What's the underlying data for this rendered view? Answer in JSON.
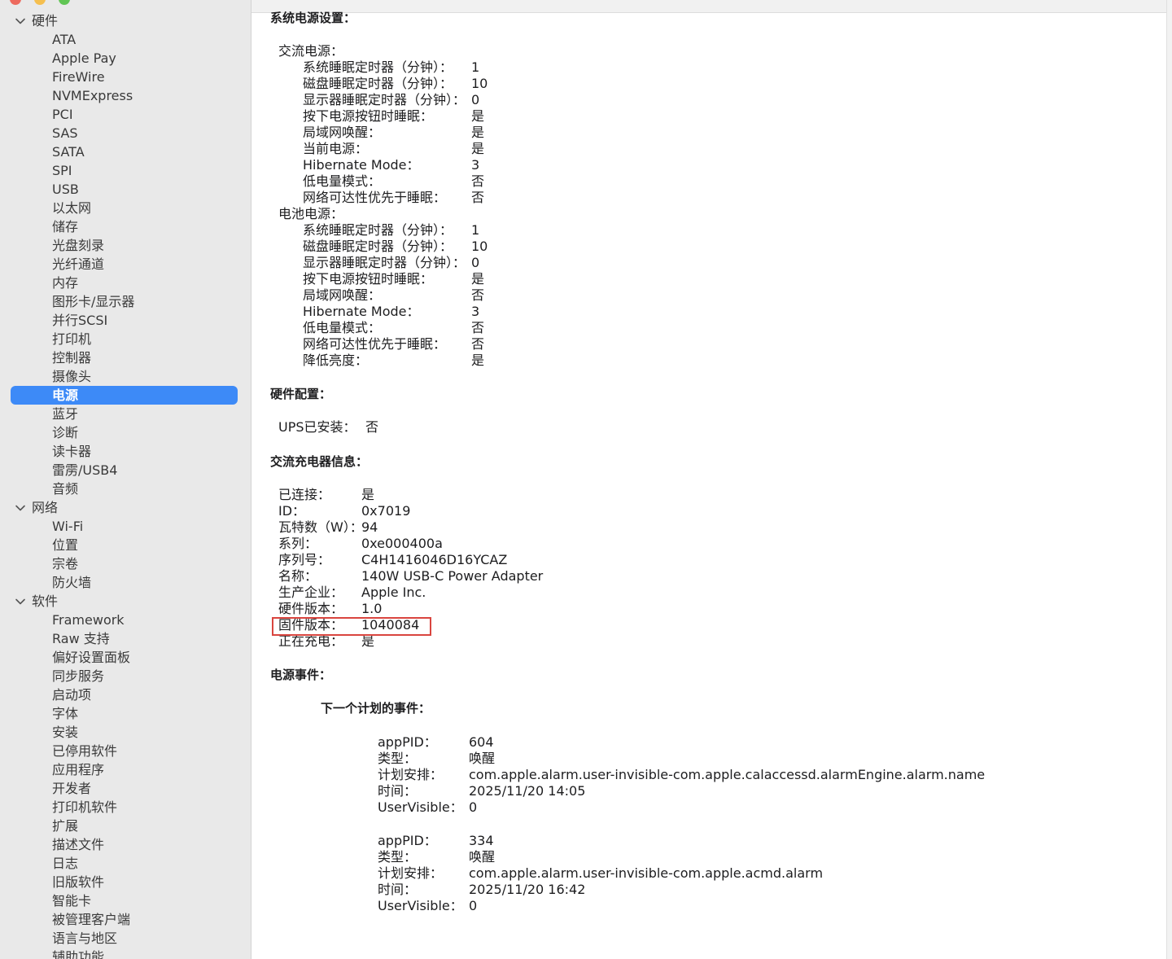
{
  "sidebar": {
    "groups": [
      {
        "label": "硬件",
        "items": [
          "ATA",
          "Apple Pay",
          "FireWire",
          "NVMExpress",
          "PCI",
          "SAS",
          "SATA",
          "SPI",
          "USB",
          "以太网",
          "储存",
          "光盘刻录",
          "光纤通道",
          "内存",
          "图形卡/显示器",
          "并行SCSI",
          "打印机",
          "控制器",
          "摄像头",
          "电源",
          "蓝牙",
          "诊断",
          "读卡器",
          "雷雳/USB4",
          "音频"
        ]
      },
      {
        "label": "网络",
        "items": [
          "Wi-Fi",
          "位置",
          "宗卷",
          "防火墙"
        ]
      },
      {
        "label": "软件",
        "items": [
          "Framework",
          "Raw 支持",
          "偏好设置面板",
          "同步服务",
          "启动项",
          "字体",
          "安装",
          "已停用软件",
          "应用程序",
          "开发者",
          "打印机软件",
          "扩展",
          "描述文件",
          "日志",
          "旧版软件",
          "智能卡",
          "被管理客户端",
          "语言与地区",
          "辅助功能"
        ]
      }
    ],
    "selected": "电源"
  },
  "main": {
    "system_power": {
      "heading": "系统电源设置：",
      "ac": {
        "label": "交流电源：",
        "rows": [
          [
            "系统睡眠定时器（分钟）：",
            "1"
          ],
          [
            "磁盘睡眠定时器（分钟）：",
            "10"
          ],
          [
            "显示器睡眠定时器（分钟）：",
            "0"
          ],
          [
            "按下电源按钮时睡眠：",
            "是"
          ],
          [
            "局域网唤醒：",
            "是"
          ],
          [
            "当前电源：",
            "是"
          ],
          [
            "Hibernate Mode：",
            "3"
          ],
          [
            "低电量模式：",
            "否"
          ],
          [
            "网络可达性优先于睡眠：",
            "否"
          ]
        ]
      },
      "battery": {
        "label": "电池电源：",
        "rows": [
          [
            "系统睡眠定时器（分钟）：",
            "1"
          ],
          [
            "磁盘睡眠定时器（分钟）：",
            "10"
          ],
          [
            "显示器睡眠定时器（分钟）：",
            "0"
          ],
          [
            "按下电源按钮时睡眠：",
            "是"
          ],
          [
            "局域网唤醒：",
            "否"
          ],
          [
            "Hibernate Mode：",
            "3"
          ],
          [
            "低电量模式：",
            "否"
          ],
          [
            "网络可达性优先于睡眠：",
            "否"
          ],
          [
            "降低亮度：",
            "是"
          ]
        ]
      }
    },
    "hardware_config": {
      "heading": "硬件配置：",
      "rows": [
        [
          "UPS已安装：",
          "否"
        ]
      ]
    },
    "ac_charger": {
      "heading": "交流充电器信息：",
      "rows": [
        [
          "已连接：",
          "是"
        ],
        [
          "ID：",
          "0x7019"
        ],
        [
          "瓦特数（W）：",
          "94"
        ],
        [
          "系列：",
          "0xe000400a"
        ],
        [
          "序列号：",
          "C4H1416046D16YCAZ"
        ],
        [
          "名称：",
          "140W USB-C Power Adapter"
        ],
        [
          "生产企业：",
          "Apple Inc."
        ],
        [
          "硬件版本：",
          "1.0"
        ],
        [
          "固件版本：",
          "1040084"
        ],
        [
          "正在充电：",
          "是"
        ]
      ]
    },
    "power_events": {
      "heading": "电源事件：",
      "subheading": "下一个计划的事件：",
      "events": [
        [
          [
            "appPID：",
            "604"
          ],
          [
            "类型：",
            "唤醒"
          ],
          [
            "计划安排：",
            "com.apple.alarm.user-invisible-com.apple.calaccessd.alarmEngine.alarm.name"
          ],
          [
            "时间：",
            "2025/11/20 14:05"
          ],
          [
            "UserVisible：",
            "0"
          ]
        ],
        [
          [
            "appPID：",
            "334"
          ],
          [
            "类型：",
            "唤醒"
          ],
          [
            "计划安排：",
            "com.apple.alarm.user-invisible-com.apple.acmd.alarm"
          ],
          [
            "时间：",
            "2025/11/20 16:42"
          ],
          [
            "UserVisible：",
            "0"
          ]
        ]
      ]
    }
  }
}
